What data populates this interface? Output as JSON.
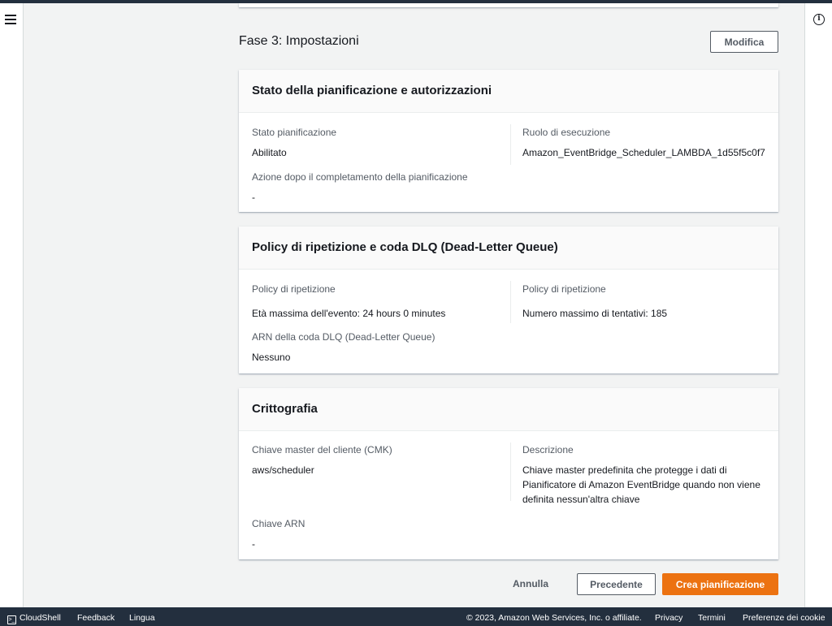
{
  "step": {
    "title": "Fase 3: Impostazioni",
    "edit_label": "Modifica"
  },
  "cards": {
    "status": {
      "title": "Stato della pianificazione e autorizzazioni",
      "stato_label": "Stato pianificazione",
      "stato_value": "Abilitato",
      "ruolo_label": "Ruolo di esecuzione",
      "ruolo_value": "Amazon_EventBridge_Scheduler_LAMBDA_1d55f5c0f7",
      "azione_label": "Azione dopo il completamento della pianificazione",
      "azione_value": "-"
    },
    "retry": {
      "title": "Policy di ripetizione e coda DLQ (Dead-Letter Queue)",
      "policy1_label": "Policy di ripetizione",
      "policy1_value": "Età massima dell'evento: 24 hours 0 minutes",
      "policy2_label": "Policy di ripetizione",
      "policy2_value": "Numero massimo di tentativi: 185",
      "dlq_label": "ARN della coda DLQ (Dead-Letter Queue)",
      "dlq_value": "Nessuno"
    },
    "crypto": {
      "title": "Crittografia",
      "cmk_label": "Chiave master del cliente (CMK)",
      "cmk_value": "aws/scheduler",
      "desc_label": "Descrizione",
      "desc_value": "Chiave master predefinita che protegge i dati di Pianificatore di Amazon EventBridge quando non viene definita nessun'altra chiave",
      "arn_label": "Chiave ARN",
      "arn_value": "-"
    }
  },
  "actions": {
    "cancel": "Annulla",
    "previous": "Precedente",
    "create": "Crea pianificazione"
  },
  "footer": {
    "cloudshell": "CloudShell",
    "feedback": "Feedback",
    "language": "Lingua",
    "copyright": "© 2023, Amazon Web Services, Inc. o affiliate.",
    "privacy": "Privacy",
    "terms": "Termini",
    "cookies": "Preferenze dei cookie"
  },
  "icons": {
    "menu": "hamburger-menu-icon",
    "info": "info-icon",
    "cloudshell": "terminal-icon"
  },
  "colors": {
    "primary": "#ec7211",
    "footer_bg": "#232f3e"
  }
}
